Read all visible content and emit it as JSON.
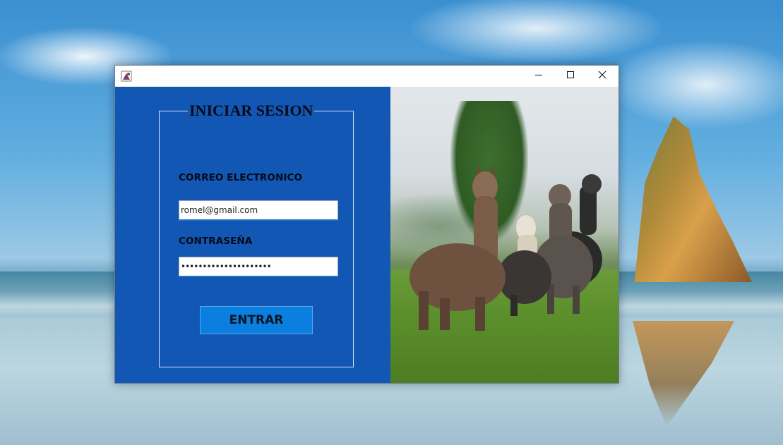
{
  "window": {
    "title": ""
  },
  "login": {
    "heading": "INICIAR SESION",
    "email_label": "CORREO ELECTRONICO",
    "email_value": "romel@gmail.com",
    "password_label": "CONTRASEÑA",
    "password_value": "•••••••••••••••••••••",
    "submit_label": "ENTRAR"
  },
  "colors": {
    "panel_bg": "#1257b3",
    "button_bg": "#0a7fe0"
  },
  "icons": {
    "app": "java-app-icon",
    "minimize": "minimize-icon",
    "maximize": "maximize-icon",
    "close": "close-icon"
  }
}
